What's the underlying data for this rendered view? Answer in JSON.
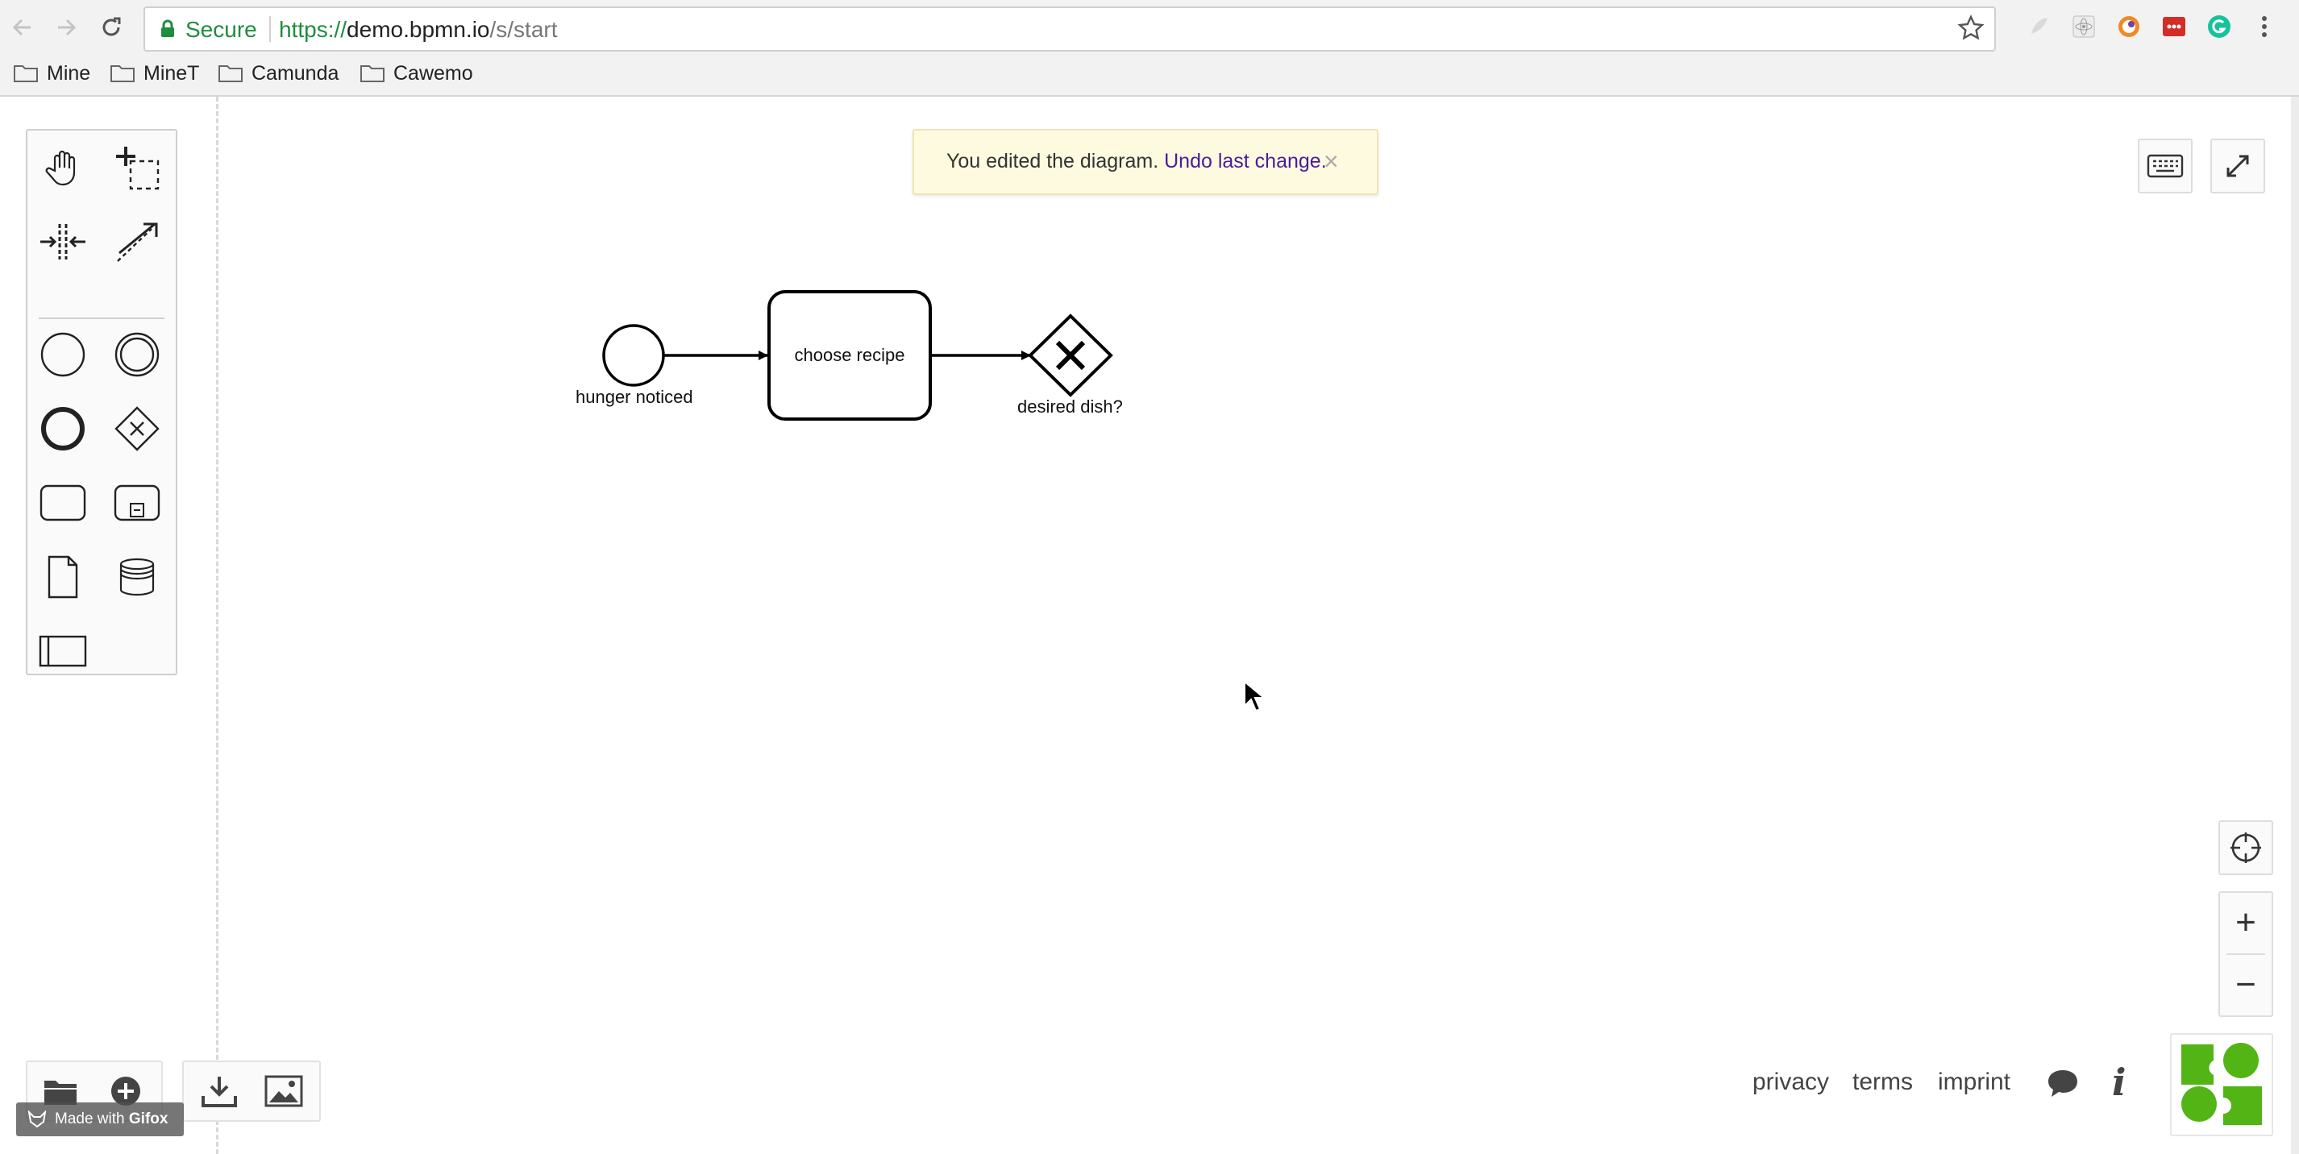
{
  "browser": {
    "secure_label": "Secure",
    "url_scheme": "https://",
    "url_host": "demo.bpmn.io",
    "url_path": "/s/start",
    "bookmarks": [
      "Mine",
      "MineT",
      "Camunda",
      "Cawemo"
    ],
    "extensions": [
      "feather-icon",
      "atom-icon",
      "colorpicker-icon",
      "lastpass-icon",
      "grammarly-icon"
    ]
  },
  "palette": {
    "tools": [
      "hand-tool-icon",
      "lasso-tool-icon",
      "space-tool-icon",
      "connect-tool-icon",
      "start-event-icon",
      "intermediate-event-icon",
      "end-event-icon",
      "gateway-icon",
      "task-icon",
      "subprocess-icon",
      "data-object-icon",
      "data-store-icon",
      "participant-icon"
    ]
  },
  "notification": {
    "message": "You edited the diagram.",
    "undo_link": "Undo last change.",
    "close": "×"
  },
  "diagram": {
    "start_event_label": "hunger noticed",
    "task_label": "choose recipe",
    "gateway_label": "desired dish?",
    "gateway_marker": "X"
  },
  "controls": {
    "zoom_in": "+",
    "zoom_out": "−"
  },
  "footer": {
    "links": [
      "privacy",
      "terms",
      "imprint"
    ],
    "info": "i"
  },
  "watermark": {
    "made_with": "Made with",
    "brand": "Gifox"
  },
  "colors": {
    "secure_green": "#1e8e3e",
    "toast_bg": "#fdfadf",
    "undo_link": "#4a1b9c",
    "logo_green": "#52b415"
  }
}
